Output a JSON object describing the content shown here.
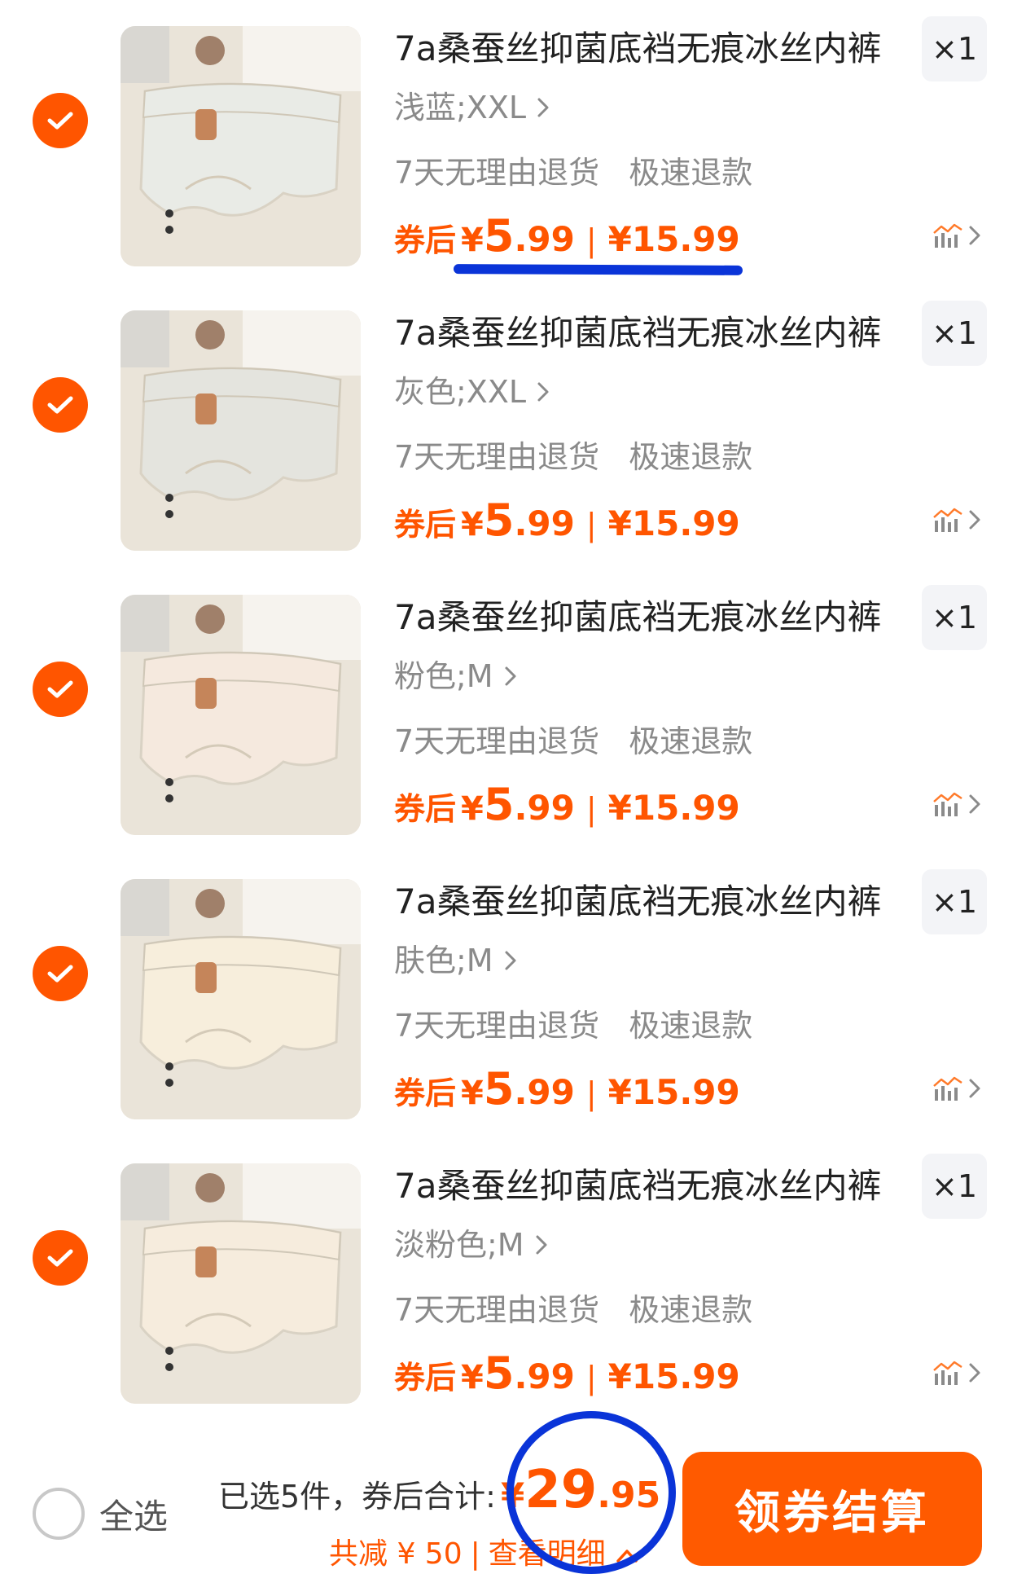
{
  "colors": {
    "accent": "#ff5500",
    "annotation": "#0a34d8",
    "text_secondary": "#8a8a8a"
  },
  "items": [
    {
      "title": "7a桑蚕丝抑菌底裆无痕冰丝内裤",
      "quantity": "×1",
      "spec": "浅蓝;XXL",
      "service1": "7天无理由退货",
      "service2": "极速退款",
      "price_label": "券后",
      "yen": "¥",
      "price_int": "5",
      "price_dec": ".99",
      "separator": "|",
      "original_price": "¥15.99",
      "color": "#e9ebe6"
    },
    {
      "title": "7a桑蚕丝抑菌底裆无痕冰丝内裤",
      "quantity": "×1",
      "spec": "灰色;XXL",
      "service1": "7天无理由退货",
      "service2": "极速退款",
      "price_label": "券后",
      "yen": "¥",
      "price_int": "5",
      "price_dec": ".99",
      "separator": "|",
      "original_price": "¥15.99",
      "color": "#e4e4de"
    },
    {
      "title": "7a桑蚕丝抑菌底裆无痕冰丝内裤",
      "quantity": "×1",
      "spec": "粉色;M",
      "service1": "7天无理由退货",
      "service2": "极速退款",
      "price_label": "券后",
      "yen": "¥",
      "price_int": "5",
      "price_dec": ".99",
      "separator": "|",
      "original_price": "¥15.99",
      "color": "#f5e9de"
    },
    {
      "title": "7a桑蚕丝抑菌底裆无痕冰丝内裤",
      "quantity": "×1",
      "spec": "肤色;M",
      "service1": "7天无理由退货",
      "service2": "极速退款",
      "price_label": "券后",
      "yen": "¥",
      "price_int": "5",
      "price_dec": ".99",
      "separator": "|",
      "original_price": "¥15.99",
      "color": "#f7eedc"
    },
    {
      "title": "7a桑蚕丝抑菌底裆无痕冰丝内裤",
      "quantity": "×1",
      "spec": "淡粉色;M",
      "service1": "7天无理由退货",
      "service2": "极速退款",
      "price_label": "券后",
      "yen": "¥",
      "price_int": "5",
      "price_dec": ".99",
      "separator": "|",
      "original_price": "¥15.99",
      "color": "#f6ecdd"
    }
  ],
  "bottom": {
    "select_all": "全选",
    "selected_text": "已选5件，券后合计:",
    "total_yen": "¥",
    "total_int": "29",
    "total_dec": ".95",
    "reduce_text": "共减 ¥ 50",
    "reduce_sep": "|",
    "detail_link": "查看明细",
    "checkout": "领券结算"
  }
}
